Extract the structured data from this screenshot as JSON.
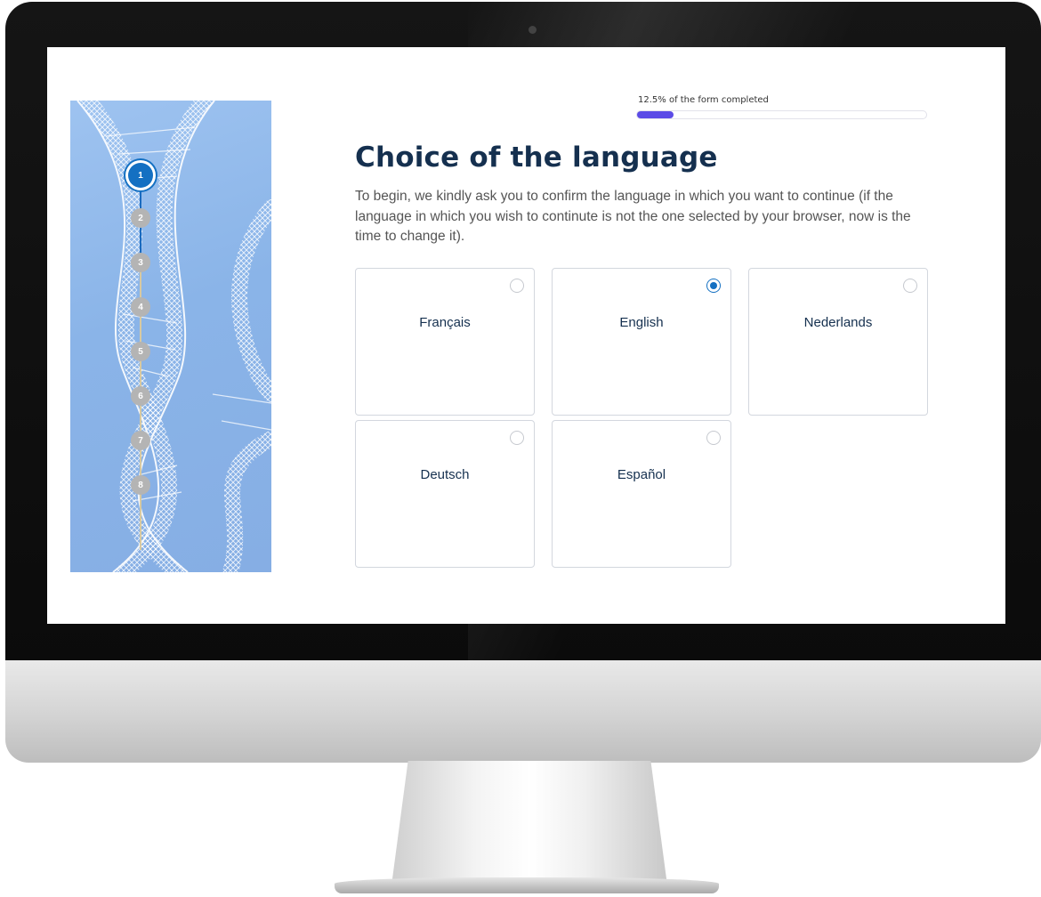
{
  "progress": {
    "label": "12.5% of the form completed",
    "fraction": 0.125,
    "fill_color": "#5b4be6"
  },
  "steps": [
    "1",
    "2",
    "3",
    "4",
    "5",
    "6",
    "7",
    "8"
  ],
  "active_step": "1",
  "page": {
    "title": "Choice of the language",
    "intro": "To begin, we kindly ask you to confirm the language in which you want to continue (if the language in which you wish to continute is not the one selected by your browser, now is the time to change it)."
  },
  "languages": [
    {
      "label": "Français",
      "selected": false
    },
    {
      "label": "English",
      "selected": true
    },
    {
      "label": "Nederlands",
      "selected": false
    },
    {
      "label": "Deutsch",
      "selected": false
    },
    {
      "label": "Español",
      "selected": false
    }
  ],
  "colors": {
    "accent": "#1470c2",
    "title": "#15304f",
    "panel": "#8ab4e8"
  }
}
